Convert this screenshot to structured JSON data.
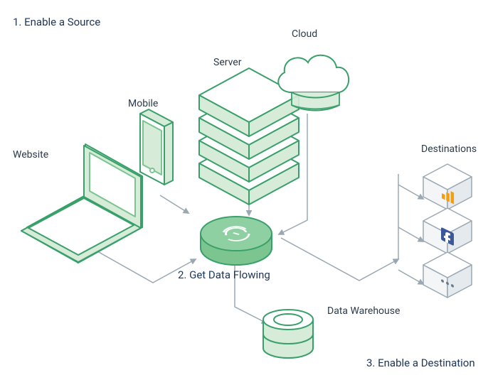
{
  "steps": {
    "step1": "1. Enable a Source",
    "step2": "2. Get Data Flowing",
    "step3": "3. Enable a Destination"
  },
  "labels": {
    "website": "Website",
    "mobile": "Mobile",
    "server": "Server",
    "cloud": "Cloud",
    "destinations": "Destinations",
    "data_warehouse": "Data Warehouse"
  },
  "colors": {
    "line": "#9aa8b3",
    "green_stroke": "#3aa06a",
    "green_fill": "#d6ecd9",
    "green_mid": "#7cc490",
    "white": "#ffffff",
    "ga_orange": "#f59e0b",
    "fb_blue": "#3b5998",
    "box_grey": "#e5eaee"
  }
}
